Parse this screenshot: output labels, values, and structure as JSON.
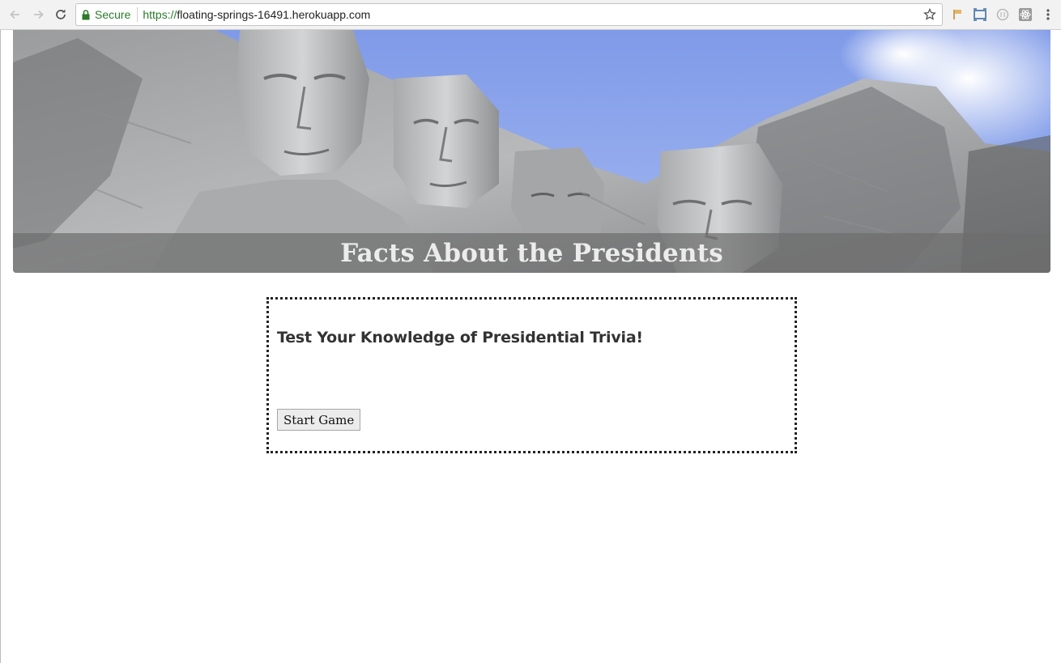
{
  "browser": {
    "secure_label": "Secure",
    "url_scheme": "https://",
    "url_host": "floating-springs-16491.herokuapp.com"
  },
  "banner": {
    "caption": "Facts About the Presidents"
  },
  "quiz": {
    "title": "Test Your Knowledge of Presidential Trivia!",
    "start_button_label": "Start Game"
  },
  "colors": {
    "secure_green": "#2a7a2a",
    "caption_bar": "#6e6e6e",
    "sky": "#8ea8ee"
  }
}
